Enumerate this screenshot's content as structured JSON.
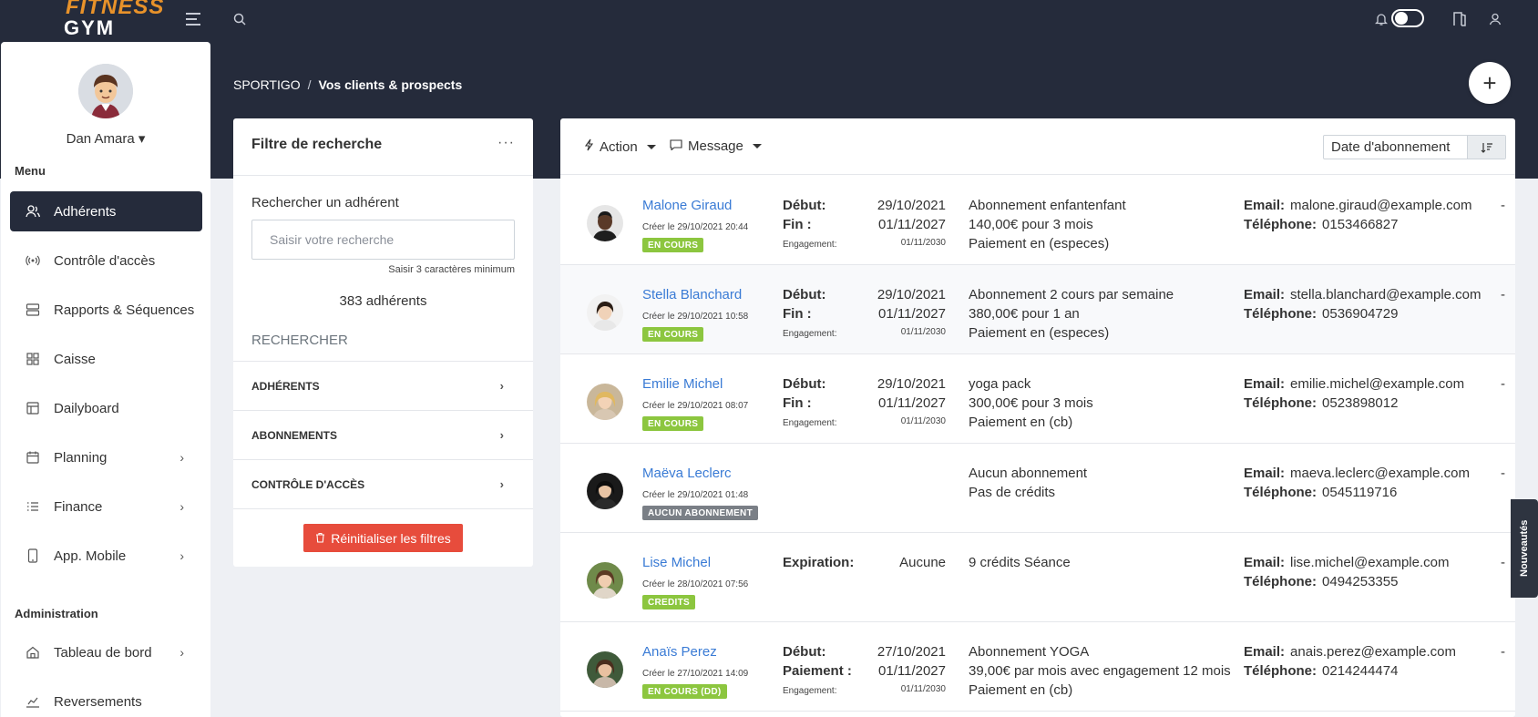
{
  "brand": {
    "logo_line1": "FITNESS",
    "logo_line2": "GYM"
  },
  "topbar": {
    "icons": [
      "menu-icon",
      "search-icon",
      "bell-icon",
      "theme-toggle",
      "door-icon",
      "user-icon"
    ]
  },
  "user": {
    "name": "Dan Amara ▾"
  },
  "sidebar": {
    "menu_title": "Menu",
    "items": [
      {
        "label": "Adhérents",
        "icon": "users-icon",
        "active": true
      },
      {
        "label": "Contrôle d'accès",
        "icon": "broadcast-icon"
      },
      {
        "label": "Rapports & Séquences",
        "icon": "server-icon"
      },
      {
        "label": "Caisse",
        "icon": "grid-icon"
      },
      {
        "label": "Dailyboard",
        "icon": "layout-icon"
      },
      {
        "label": "Planning",
        "icon": "calendar-icon",
        "chevron": "›"
      },
      {
        "label": "Finance",
        "icon": "list-icon",
        "chevron": "›"
      },
      {
        "label": "App. Mobile",
        "icon": "mobile-icon",
        "chevron": "›"
      }
    ],
    "admin_title": "Administration",
    "admin_items": [
      {
        "label": "Tableau de bord",
        "icon": "home-icon",
        "chevron": "›"
      },
      {
        "label": "Reversements",
        "icon": "transfer-icon"
      }
    ]
  },
  "breadcrumb": {
    "root": "SPORTIGO",
    "sep": "/",
    "current": "Vos clients & prospects"
  },
  "fab": {
    "label": "+"
  },
  "filter": {
    "title": "Filtre de recherche",
    "more": "···",
    "search_label": "Rechercher un adhérent",
    "search_placeholder": "Saisir votre recherche",
    "search_hint": "Saisir 3 caractères minimum",
    "count": "383 adhérents",
    "section": "RECHERCHER",
    "accordions": [
      "ADHÉRENTS",
      "ABONNEMENTS",
      "CONTRÔLE D'ACCÈS"
    ],
    "chev": "›",
    "reset": "Réinitialiser les filtres"
  },
  "list_header": {
    "action": "Action",
    "message": "Message",
    "sort_value": "Date d'abonnement"
  },
  "labels": {
    "debut": "Début:",
    "fin": "Fin :",
    "engagement": "Engagement:",
    "paiement": "Paiement :",
    "expiration": "Expiration:",
    "email": "Email:",
    "telephone": "Téléphone:",
    "dash": "-"
  },
  "members": [
    {
      "name": "Malone Giraud",
      "created": "Créer le 29/10/2021 20:44",
      "badge": "EN COURS",
      "debut": "29/10/2021",
      "fin": "01/11/2027",
      "engagement": "01/11/2030",
      "desc": [
        "Abonnement enfantenfant",
        "140,00€ pour 3 mois",
        "Paiement en (especes)"
      ],
      "email": "malone.giraud@example.com",
      "phone": "0153466827"
    },
    {
      "name": "Stella Blanchard",
      "created": "Créer le 29/10/2021 10:58",
      "badge": "EN COURS",
      "debut": "29/10/2021",
      "fin": "01/11/2027",
      "engagement": "01/11/2030",
      "desc": [
        "Abonnement 2 cours par semaine",
        "380,00€ pour 1 an",
        "Paiement en (especes)"
      ],
      "email": "stella.blanchard@example.com",
      "phone": "0536904729"
    },
    {
      "name": "Emilie Michel",
      "created": "Créer le 29/10/2021 08:07",
      "badge": "EN COURS",
      "debut": "29/10/2021",
      "fin": "01/11/2027",
      "engagement": "01/11/2030",
      "desc": [
        "yoga pack",
        "300,00€ pour 3 mois",
        "Paiement en (cb)"
      ],
      "email": "emilie.michel@example.com",
      "phone": "0523898012"
    },
    {
      "name": "Maëva Leclerc",
      "created": "Créer le 29/10/2021 01:48",
      "badge": "AUCUN ABONNEMENT",
      "desc": [
        "Aucun abonnement",
        "Pas de crédits"
      ],
      "email": "maeva.leclerc@example.com",
      "phone": "0545119716"
    },
    {
      "name": "Lise Michel",
      "created": "Créer le 28/10/2021 07:56",
      "badge": "CREDITS",
      "expiration": "Aucune",
      "desc": [
        "9 crédits Séance"
      ],
      "email": "lise.michel@example.com",
      "phone": "0494253355"
    },
    {
      "name": "Anaïs Perez",
      "created": "Créer le 27/10/2021 14:09",
      "badge": "EN COURS (DD)",
      "debut": "27/10/2021",
      "paiement": "01/11/2027",
      "engagement": "01/11/2030",
      "desc": [
        "Abonnement YOGA",
        "39,00€ par mois avec engagement 12 mois",
        "Paiement en (cb)"
      ],
      "email": "anais.perez@example.com",
      "phone": "0214244474"
    }
  ],
  "side_tab": "Nouveautés",
  "colors": {
    "dark": "#252b3b",
    "link": "#3a7bd5",
    "green": "#8cc63f",
    "red": "#e74c3c"
  }
}
